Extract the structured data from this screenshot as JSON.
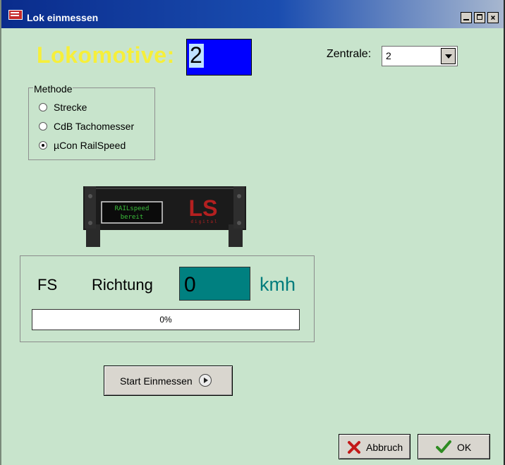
{
  "window": {
    "title": "Lok einmessen",
    "minimize": "_",
    "maximize": "□",
    "close": "×"
  },
  "lokomotive": {
    "label": "Lokomotive:",
    "value": "2"
  },
  "zentrale": {
    "label": "Zentrale:",
    "value": "2"
  },
  "methode": {
    "legend": "Methode",
    "options": [
      {
        "label": "Strecke",
        "checked": false
      },
      {
        "label": "CdB Tachomesser",
        "checked": false
      },
      {
        "label": "µCon RailSpeed",
        "checked": true
      }
    ]
  },
  "device": {
    "display_line1": "RAILspeed",
    "display_line2": "bereit",
    "brand": "LS",
    "brand_sub": "digital"
  },
  "measurement": {
    "fs_label": "FS",
    "richtung_label": "Richtung",
    "speed_value": "0",
    "speed_unit": "kmh",
    "progress_text": "0%",
    "progress_fraction": 0
  },
  "buttons": {
    "start": "Start Einmessen",
    "abbruch": "Abbruch",
    "ok": "OK"
  },
  "colors": {
    "background": "#c8e4cc",
    "titlebar": "#0a2c8c",
    "lokomotive_label": "#f6ef3a",
    "lokomotive_input": "#0000ff",
    "speed_box": "#008080",
    "kmh_text": "#007c7c"
  }
}
